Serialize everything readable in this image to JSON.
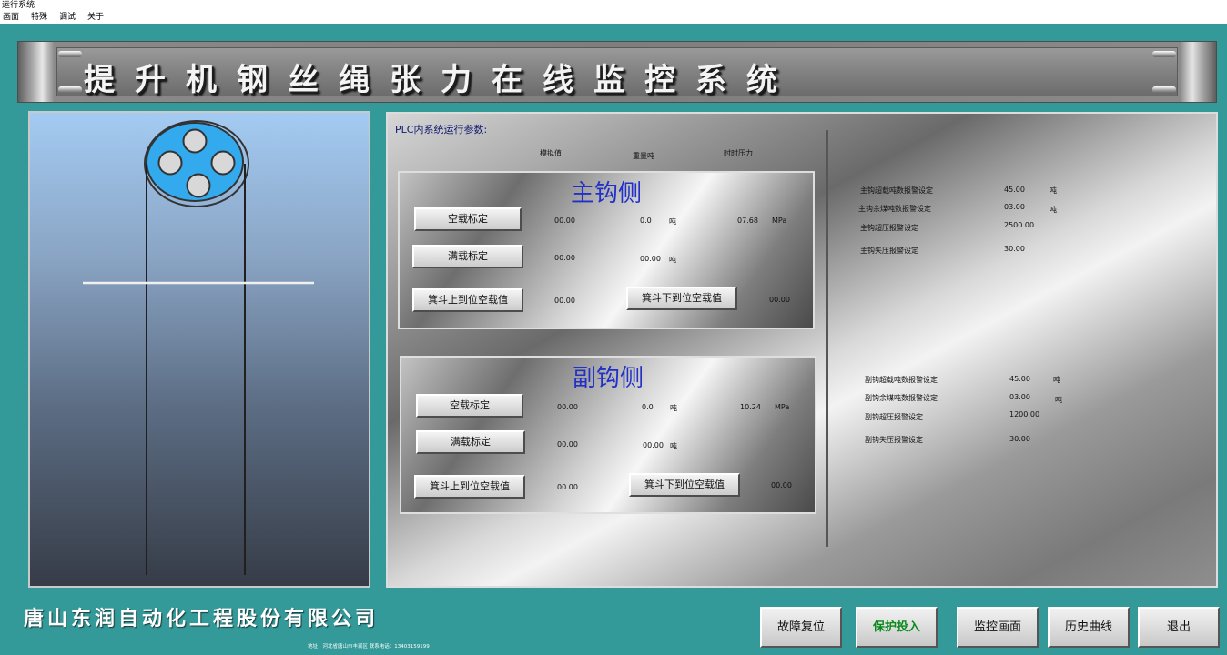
{
  "window": {
    "title": "运行系统"
  },
  "menu": [
    "画面",
    "特殊",
    "调试",
    "关于"
  ],
  "banner": {
    "title": "提升机钢丝绳张力在线监控系统"
  },
  "plc": {
    "label": "PLC内系统运行参数:",
    "headers": {
      "analog": "模拟值",
      "weight": "重量吨",
      "pressure": "时时压力"
    }
  },
  "main_hook": {
    "title": "主钩侧",
    "empty_btn": "空载标定",
    "full_btn": "满载标定",
    "skip_up_btn": "箕斗上到位空载值",
    "skip_down_btn": "箕斗下到位空载值",
    "empty_analog": "00.00",
    "empty_weight": "0.0",
    "empty_weight_unit": "吨",
    "pressure": "07.68",
    "pressure_unit": "MPa",
    "full_analog": "00.00",
    "full_weight": "00.00",
    "full_weight_unit": "吨",
    "skip_up_val": "00.00",
    "skip_down_val": "00.00"
  },
  "aux_hook": {
    "title": "副钩侧",
    "empty_btn": "空载标定",
    "full_btn": "满载标定",
    "skip_up_btn": "箕斗上到位空载值",
    "skip_down_btn": "箕斗下到位空载值",
    "empty_analog": "00.00",
    "empty_weight": "0.0",
    "empty_weight_unit": "吨",
    "pressure": "10.24",
    "pressure_unit": "MPa",
    "full_analog": "00.00",
    "full_weight": "00.00",
    "full_weight_unit": "吨",
    "skip_up_val": "00.00",
    "skip_down_val": "00.00"
  },
  "main_settings": [
    {
      "label": "主钩超载吨数报警设定",
      "value": "45.00",
      "unit": "吨"
    },
    {
      "label": "主钩余煤吨数报警设定",
      "value": "03.00",
      "unit": "吨"
    },
    {
      "label": "主钩超压报警设定",
      "value": "2500.00",
      "unit": ""
    },
    {
      "label": "主钩失压报警设定",
      "value": "30.00",
      "unit": ""
    }
  ],
  "aux_settings": [
    {
      "label": "副钩超载吨数报警设定",
      "value": "45.00",
      "unit": "吨"
    },
    {
      "label": "副钩余煤吨数报警设定",
      "value": "03.00",
      "unit": "吨"
    },
    {
      "label": "副钩超压报警设定",
      "value": "1200.00",
      "unit": ""
    },
    {
      "label": "副钩失压报警设定",
      "value": "30.00",
      "unit": ""
    }
  ],
  "footer": {
    "company": "唐山东润自动化工程股份有限公司",
    "address": "地址：河北省唐山市丰润区   联系电话：13403159199"
  },
  "buttons": {
    "fault_reset": "故障复位",
    "protect": "保护投入",
    "monitor": "监控画面",
    "history": "历史曲线",
    "exit": "退出"
  },
  "colors": {
    "background": "#339999",
    "hook_title": "#2230c8",
    "protect_active": "#0a8a1c",
    "sheave": "#33aaee"
  }
}
